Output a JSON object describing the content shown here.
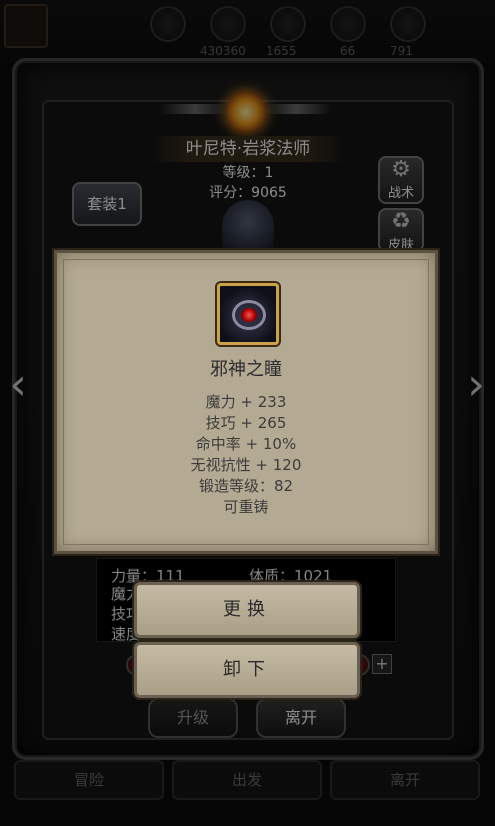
{
  "top_bar": {
    "resources": [
      "430360",
      "1655",
      "66",
      "791"
    ]
  },
  "hero": {
    "name": "叶尼特·岩浆法师",
    "level": "等级：1",
    "score": "评分：9065"
  },
  "buttons": {
    "set": "套装1",
    "tactics": "战术",
    "skin": "皮肤",
    "upgrade": "升级",
    "leave_frame": "离开"
  },
  "nav": {
    "adventure": "冒险",
    "depart": "出发",
    "leave": "离开"
  },
  "stats": {
    "strength": "力量：111",
    "constitution": "体质：1021",
    "row2": "魔力",
    "row3": "技巧",
    "row4": "速度"
  },
  "item": {
    "name": "邪神之瞳",
    "attributes": [
      "魔力 + 233",
      "技巧 + 265",
      "命中率 + 10%",
      "无视抗性 + 120",
      "锻造等级：82",
      "可重铸"
    ]
  },
  "actions": {
    "replace": "更换",
    "unequip": "卸下"
  },
  "icons": {
    "left_arrow": "chevron-left",
    "right_arrow": "chevron-right",
    "tactics": "gear",
    "skin": "recycle",
    "emblem": "sun-gem"
  }
}
